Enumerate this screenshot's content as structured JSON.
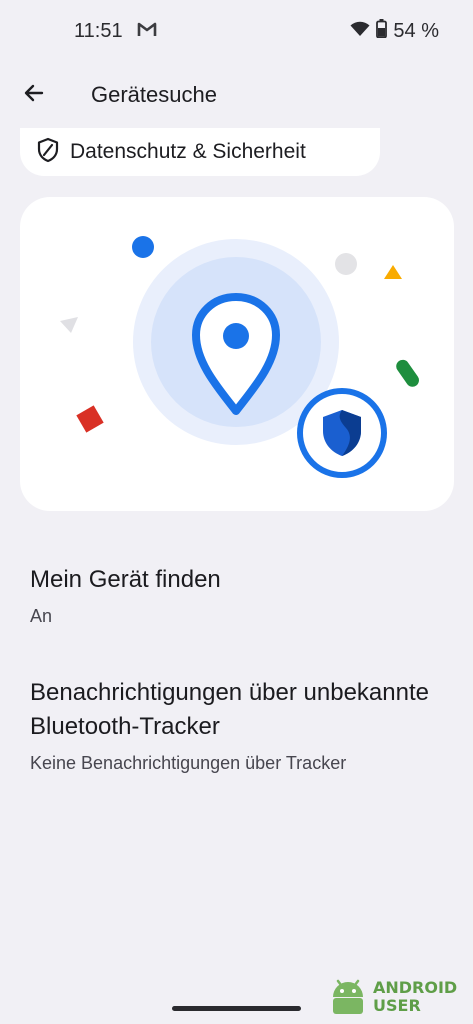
{
  "status_bar": {
    "time": "11:51",
    "notification_icon": "gmail-icon",
    "battery": "54 %",
    "icons": [
      "wifi-icon",
      "battery-icon"
    ]
  },
  "top_bar": {
    "back_icon": "arrow-back-icon",
    "title": "Gerätesuche"
  },
  "chip": {
    "icon": "shield-icon",
    "label": "Datenschutz & Sicherheit"
  },
  "hero": {
    "illustration": "location-pin-with-shield-illustration",
    "colors": {
      "blue": "#1a73e8",
      "red": "#d93025",
      "green": "#1e8e3e",
      "yellow": "#f9ab00",
      "ring_outer": "#e9effc",
      "ring_inner": "#d6e3fa"
    }
  },
  "settings": [
    {
      "title": "Mein Gerät finden",
      "subtitle": "An"
    },
    {
      "title": "Benachrichtigungen über unbekannte Bluetooth-Tracker",
      "subtitle": "Keine Benachrichtigungen über Tracker"
    }
  ],
  "watermark": {
    "line1": "ANDROID",
    "line2": "USER",
    "color": "#5f9e48"
  }
}
